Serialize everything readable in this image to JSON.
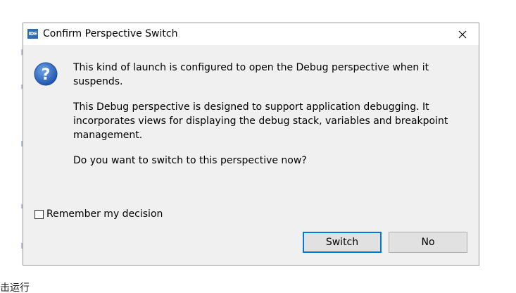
{
  "dialog": {
    "app_icon_text": "IDE",
    "title": "Confirm Perspective Switch",
    "close_icon": "close-icon",
    "question_icon": "question-icon",
    "message_paragraphs": [
      "This kind of launch is configured to open the Debug perspective when it suspends.",
      "This Debug perspective is designed to support application debugging. It incorporates views for displaying the debug stack, variables and breakpoint management.",
      "Do you want to switch to this perspective now?"
    ],
    "remember_label": "Remember my decision",
    "remember_checked": false,
    "buttons": {
      "switch": "Switch",
      "no": "No"
    },
    "colors": {
      "default_button_border": "#0078d7",
      "question_icon": "#2e6bc4"
    }
  },
  "background": {
    "partial_text": "击运行"
  }
}
